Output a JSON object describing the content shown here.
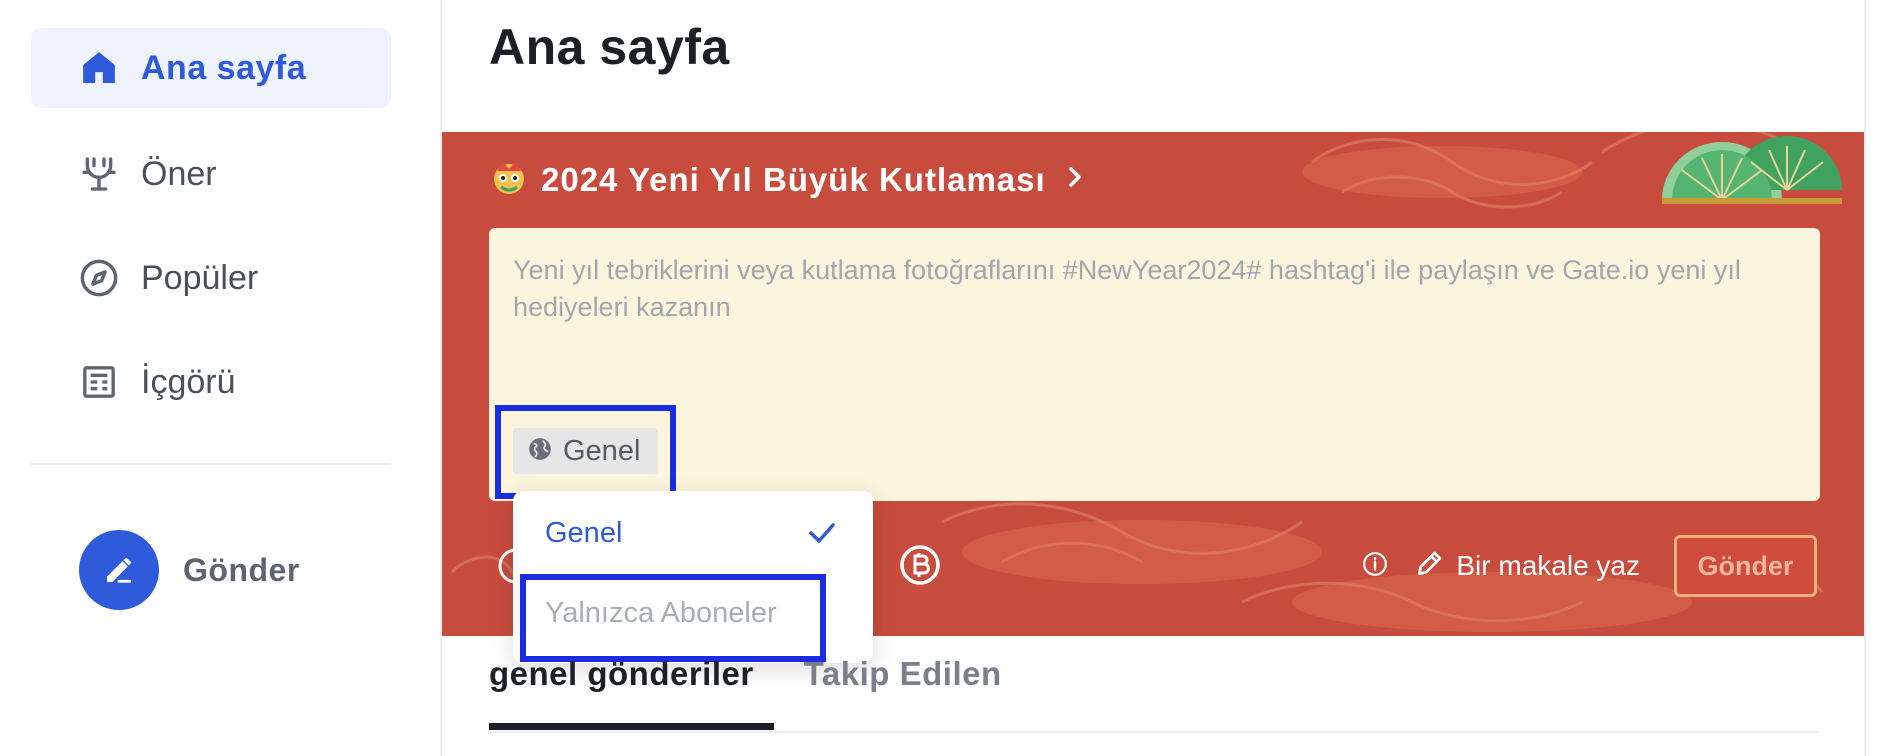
{
  "sidebar": {
    "items": [
      {
        "label": "Ana sayfa",
        "icon": "home-icon",
        "active": true
      },
      {
        "label": "Öner",
        "icon": "recommend-icon",
        "active": false
      },
      {
        "label": "Popüler",
        "icon": "compass-icon",
        "active": false
      },
      {
        "label": "İçgörü",
        "icon": "insight-icon",
        "active": false
      }
    ],
    "post_label": "Gönder",
    "post_icon": "pencil-icon"
  },
  "main": {
    "title": "Ana sayfa"
  },
  "banner": {
    "title": "2024 Yeni Yıl Büyük Kutlaması",
    "composer_placeholder": "Yeni yıl tebriklerini veya kutlama fotoğraflarını #NewYear2024# hashtag'i ile paylaşın ve Gate.io yeni yıl hediyeleri kazanın",
    "audience_label": "Genel",
    "write_article_label": "Bir makale yaz",
    "send_label": "Gönder",
    "colors": {
      "banner_bg": "#c84c3e",
      "composer_bg": "#fcf5dd",
      "accent": "#2f5ad9",
      "highlight": "#1a2de3"
    }
  },
  "dropdown": {
    "options": [
      {
        "label": "Genel",
        "selected": true
      },
      {
        "label": "Yalnızca Aboneler",
        "selected": false
      }
    ]
  },
  "tabs": [
    {
      "label": "genel gönderiler",
      "active": true
    },
    {
      "label": "Takip Edilen",
      "active": false
    }
  ]
}
